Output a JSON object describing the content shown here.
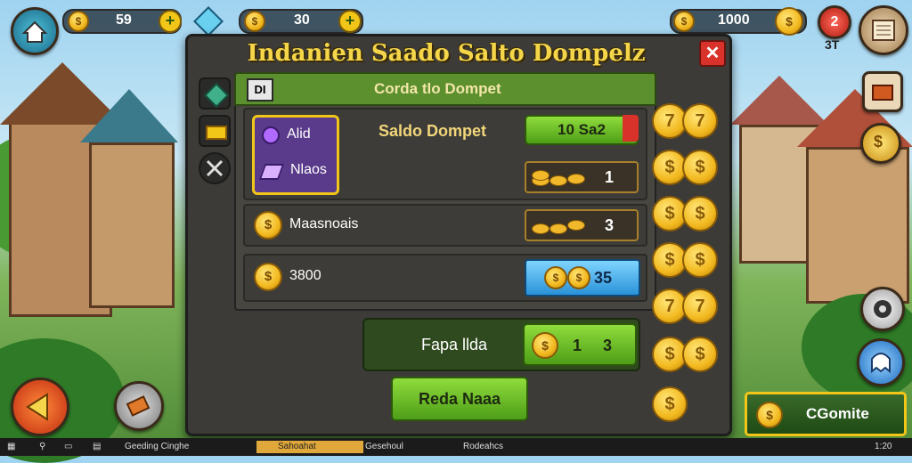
{
  "top": {
    "coins_left": "59",
    "coins_middle": "30",
    "coins_right": "1000",
    "notif_badge": "2",
    "notif_sub": "3T"
  },
  "dialog": {
    "title": "Indanien Saado Salto Dompelz",
    "tab_label": "Corda tlo Dompet",
    "tab_icon_text": "DI",
    "close_symbol": "✕"
  },
  "rows": {
    "item1_label": "Alid",
    "item2_label": "Nlaos",
    "balance_label": "Saldo Dompet",
    "balance_value": "10 Sa2",
    "stack_value": "1",
    "mission_label": "Maasnoais",
    "mission_value": "3",
    "coin_label": "3800",
    "coin_value": "35"
  },
  "footer": {
    "label": "Fapa llda",
    "value_a": "1",
    "value_b": "3",
    "button": "Reda Naaa"
  },
  "side_coins": [
    "7",
    "$",
    "$",
    "$",
    "7",
    "$",
    "$"
  ],
  "right_button": "CGomite",
  "taskbar": {
    "item1": "Geeding Cinghe",
    "item2": "Sahoahat",
    "item3": "Gesehoul",
    "item4": "Rodeahcs",
    "tray": "1:20"
  },
  "colors": {
    "accent_green": "#6fbf2a",
    "title_gold": "#f5d64a",
    "close_red": "#d8322a",
    "blue_field": "#3aa7e0"
  }
}
